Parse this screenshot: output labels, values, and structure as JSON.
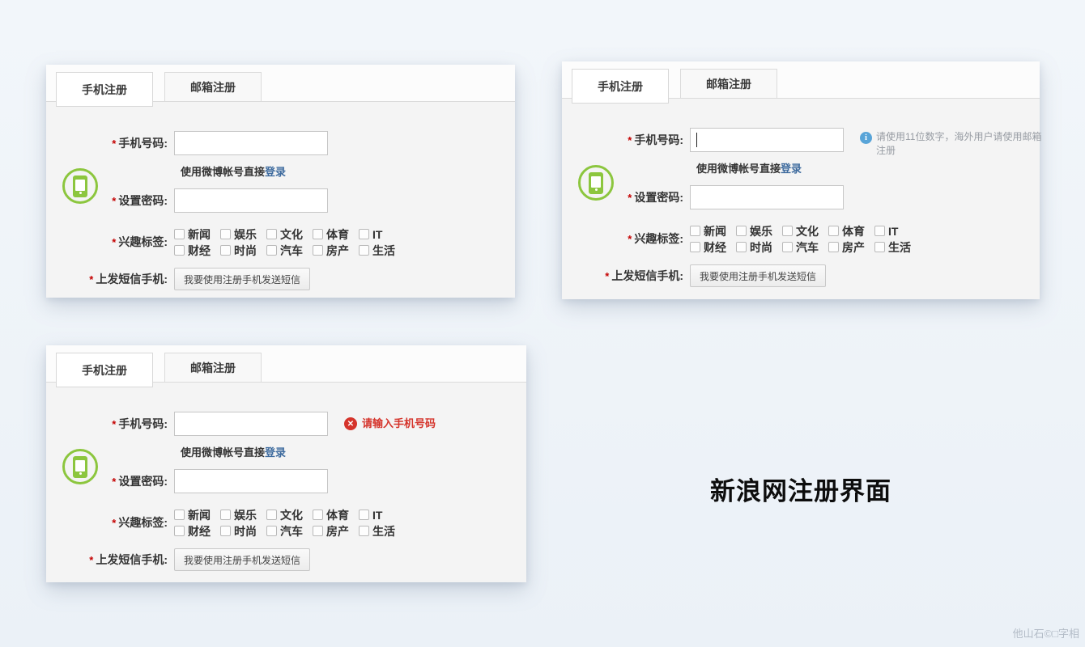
{
  "page": {
    "title": "新浪网注册界面",
    "watermark": "他山石©□字相"
  },
  "tabs": {
    "phone_label": "手机注册",
    "email_label": "邮箱注册"
  },
  "form": {
    "required_mark": "*",
    "phone_label": "手机号码:",
    "weibo_prefix": "使用微博帐号直接",
    "weibo_link": "登录",
    "password_label": "设置密码:",
    "tags_label": "兴趣标签:",
    "sms_label": "上发短信手机:",
    "sms_button_label": "我要使用注册手机发送短信",
    "tag_rows": [
      [
        "新闻",
        "娱乐",
        "文化",
        "体育",
        "IT"
      ],
      [
        "财经",
        "时尚",
        "汽车",
        "房产",
        "生活"
      ]
    ]
  },
  "panels": [
    {
      "name": "panel-default"
    },
    {
      "name": "panel-focused",
      "info_icon": "i",
      "info_text": "请使用11位数字，海外用户请使用邮箱注册"
    },
    {
      "name": "panel-error",
      "error_icon": "✕",
      "error_text": "请输入手机号码"
    }
  ],
  "colors": {
    "accent_green": "#8cc63e",
    "link_blue": "#3e6b9e",
    "error_red": "#d5342b",
    "info_blue": "#58a4d8",
    "asterisk_red": "#c40000"
  }
}
